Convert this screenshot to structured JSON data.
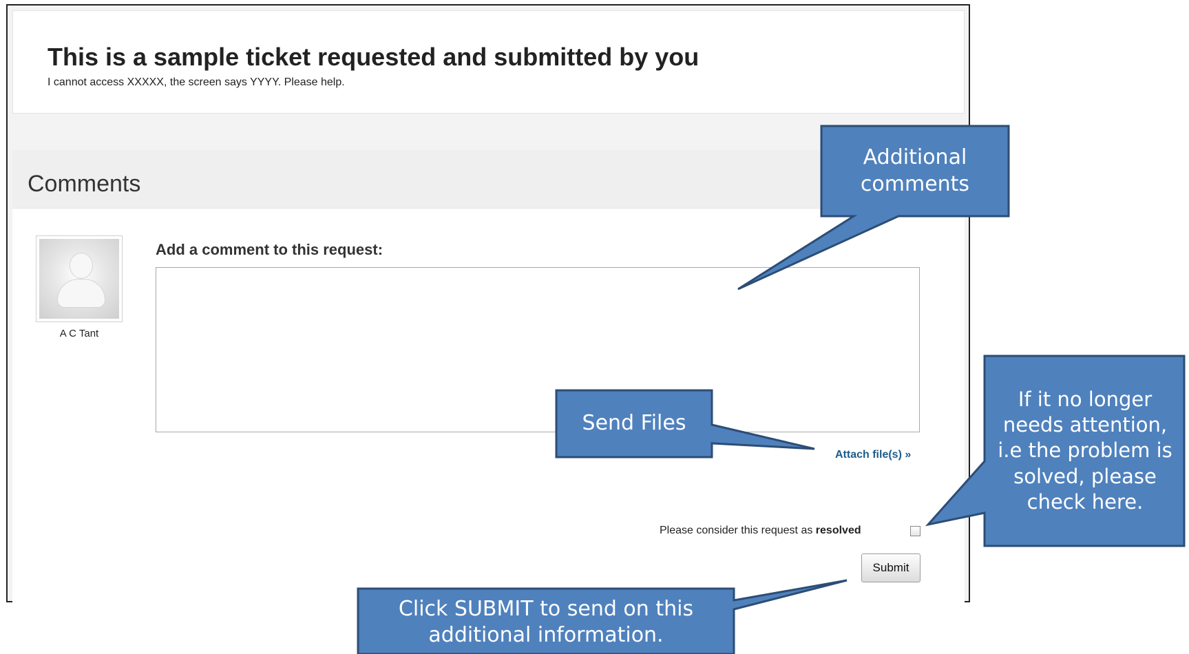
{
  "ticket": {
    "title": "This is a sample ticket requested and submitted by you",
    "description": "I cannot access XXXXX, the screen says YYYY. Please help."
  },
  "comments": {
    "heading": "Comments",
    "user_name": "A C Tant",
    "add_label": "Add a comment to this request:",
    "comment_value": "",
    "attach_label": "Attach file(s) »",
    "resolve_prefix": "Please consider this request as ",
    "resolve_bold": "resolved",
    "submit_label": "Submit"
  },
  "callouts": {
    "additional_comments": "Additional comments",
    "send_files": "Send Files",
    "resolved_hint": "If it no longer needs attention, i.e the problem is solved, please check here.",
    "submit_hint": "Click SUBMIT to send on this additional information."
  },
  "colors": {
    "callout_fill": "#4f81bd",
    "callout_border": "#2c4d75",
    "link": "#1b5c8c"
  }
}
